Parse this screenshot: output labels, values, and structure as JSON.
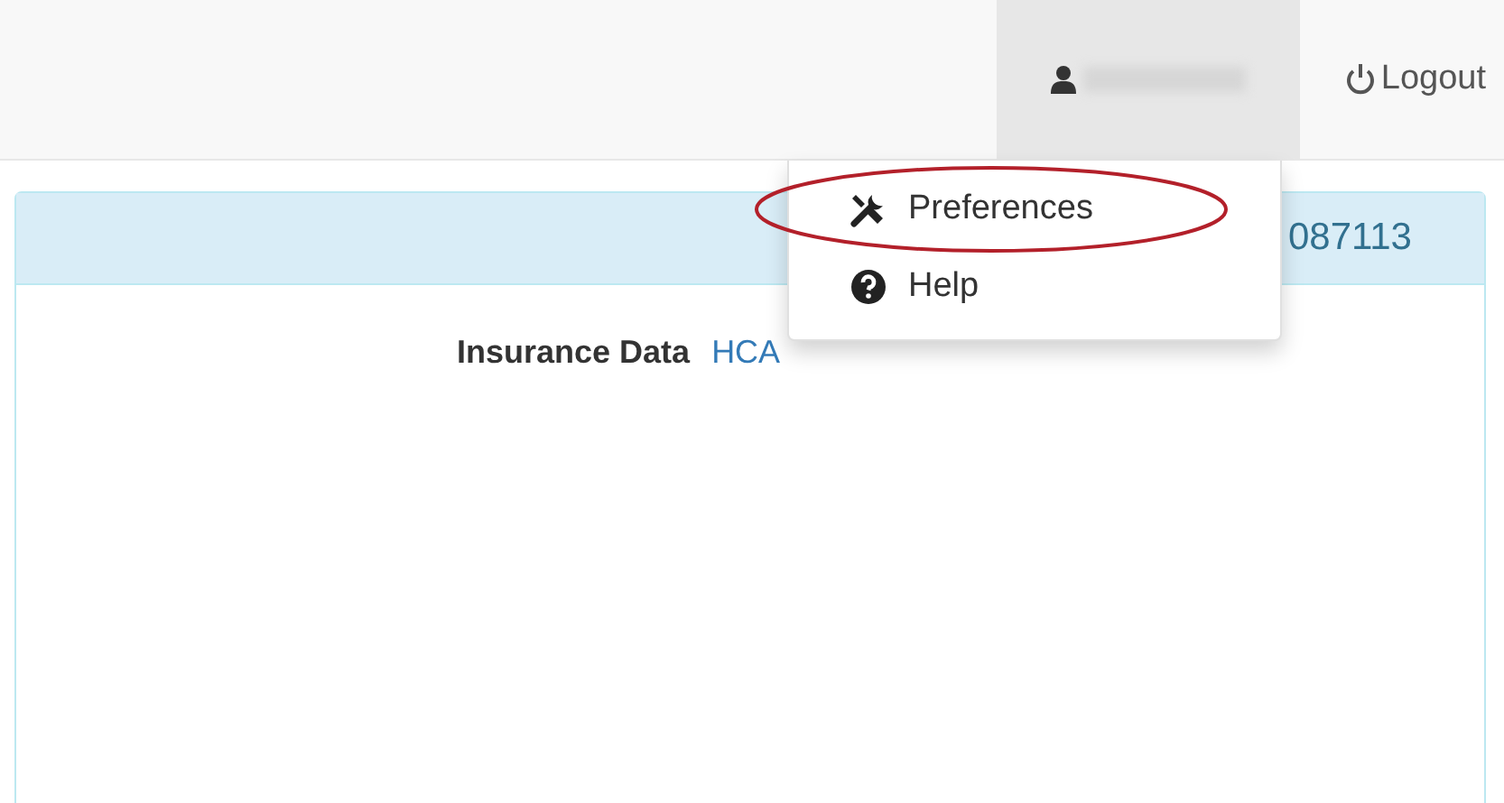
{
  "navbar": {
    "user": {
      "blurred": true,
      "expanded": true
    },
    "logout": {
      "label": "Logout"
    }
  },
  "user_menu": [
    {
      "label": "Preferences",
      "kind": "tools",
      "highlighted": true
    },
    {
      "label": "Help",
      "kind": "help",
      "highlighted": false
    }
  ],
  "panel": {
    "heading": "087113",
    "fields": [
      {
        "label": "Insurance Data",
        "value": "HCA"
      }
    ]
  }
}
